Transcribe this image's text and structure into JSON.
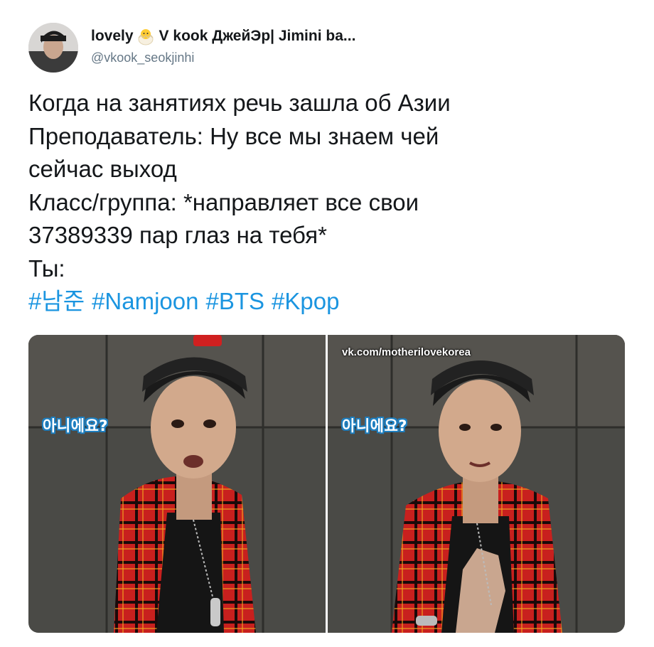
{
  "tweet": {
    "author": {
      "display_name_pre": "lovely",
      "display_name_post": "V kook ДжейЭр| Jimini ba...",
      "emoji_icon": "hatching-chick-icon",
      "handle": "@vkook_seokjinhi"
    },
    "lines": [
      "Когда на занятиях речь зашла об Азии",
      "Преподаватель: Ну все мы знаем чей",
      "сейчас выход",
      "Класс/группа: *направляет все свои",
      "37389339 пар глаз на тебя*",
      "Ты:"
    ],
    "hashtags": [
      "#남준",
      "#Namjoon",
      "#BTS",
      "#Kpop"
    ],
    "media": {
      "left_caption": "아니에요?",
      "right_caption": "아니에요?",
      "watermark": "vk.com/motherilovekorea"
    }
  },
  "colors": {
    "hashtag": "#1b95e0",
    "handle": "#657786",
    "text": "#14171a",
    "caption_outline": "#1e7fc0"
  }
}
